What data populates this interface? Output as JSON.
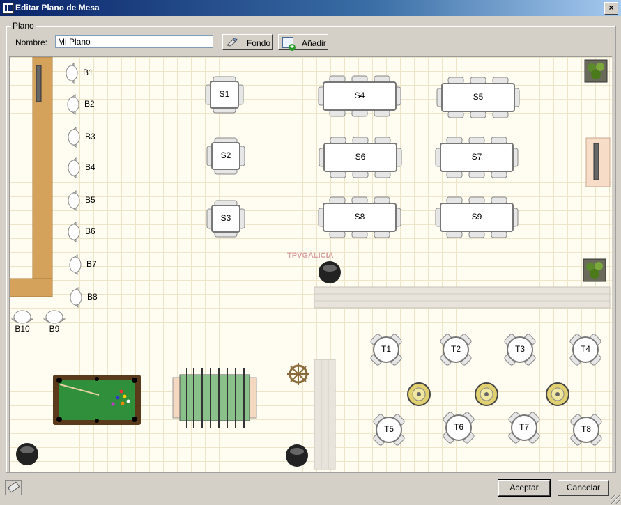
{
  "window": {
    "title": "Editar Plano de Mesa"
  },
  "group": {
    "label": "Plano"
  },
  "form": {
    "name_label": "Nombre:",
    "name_value": "Mi Plano"
  },
  "toolbar": {
    "fondo_label": "Fondo",
    "anadir_label": "Añadir"
  },
  "watermark": "TPVGALICIA",
  "tables": {
    "small": [
      "S1",
      "S2",
      "S3"
    ],
    "large": [
      "S4",
      "S5",
      "S6",
      "S7",
      "S8",
      "S9"
    ],
    "round": [
      "T1",
      "T2",
      "T3",
      "T4",
      "T5",
      "T6",
      "T7",
      "T8"
    ],
    "bar_stools": [
      "B1",
      "B2",
      "B3",
      "B4",
      "B5",
      "B6",
      "B7",
      "B8"
    ],
    "stools_bottom": [
      "B10",
      "B9"
    ]
  },
  "footer": {
    "accept_label": "Aceptar",
    "cancel_label": "Cancelar"
  },
  "colors": {
    "titlebar_start": "#0a246a",
    "titlebar_end": "#a6caf0",
    "canvas_bg": "#fffdf2",
    "bar_wood": "#d4a25a",
    "pool_felt": "#2f8f3a"
  }
}
